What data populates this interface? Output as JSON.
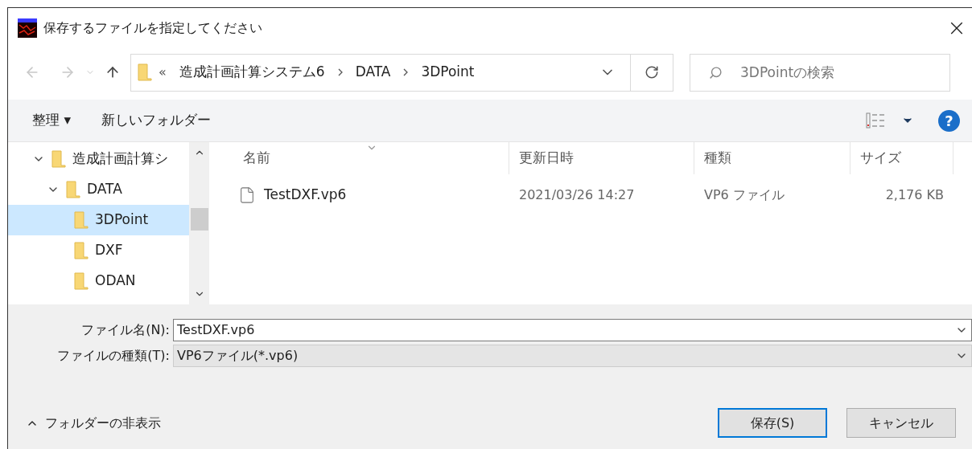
{
  "window": {
    "title": "保存するファイルを指定してください",
    "close": "×"
  },
  "nav": {
    "back_enabled": false,
    "forward_enabled": false
  },
  "address": {
    "overflow": "«",
    "crumbs": [
      "造成計画計算システム6",
      "DATA",
      "3DPoint"
    ]
  },
  "search": {
    "placeholder": "3DPointの検索"
  },
  "toolbar": {
    "organize": "整理 ▾",
    "new_folder": "新しいフォルダー",
    "help": "?"
  },
  "tree": [
    {
      "label": "造成計画計算シ",
      "expanded": true,
      "selected": false,
      "children": [
        {
          "label": "DATA",
          "expanded": true,
          "selected": false,
          "children": [
            {
              "label": "3DPoint",
              "selected": true
            },
            {
              "label": "DXF",
              "selected": false
            },
            {
              "label": "ODAN",
              "selected": false
            }
          ]
        }
      ]
    }
  ],
  "table": {
    "columns": [
      "名前",
      "更新日時",
      "種類",
      "サイズ"
    ],
    "rows": [
      {
        "name": "TestDXF.vp6",
        "modified": "2021/03/26 14:27",
        "type": "VP6 ファイル",
        "size": "2,176 KB",
        "selected": false
      }
    ]
  },
  "form": {
    "file_name_label": "ファイル名(N):",
    "file_name": "TestDXF.vp6",
    "file_type_label": "ファイルの種類(T):",
    "file_type": "VP6ファイル(*.vp6)"
  },
  "footer": {
    "hide_folders": "フォルダーの非表示",
    "save": "保存(S)",
    "cancel": "キャンセル"
  }
}
